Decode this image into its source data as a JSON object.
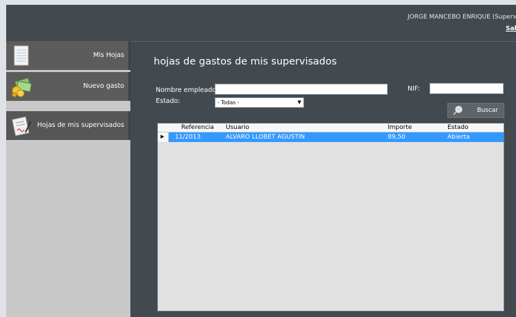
{
  "header": {
    "user": "JORGE MANCEBO ENRIQUE (Supervisor",
    "logout": "Sali"
  },
  "sidebar": {
    "items": [
      {
        "label": "Mis Hojas",
        "icon": "notepad-icon"
      },
      {
        "label": "Nuevo gasto",
        "icon": "money-icon"
      },
      {
        "label": "Hojas de mis supervisados",
        "icon": "signed-document-icon"
      }
    ]
  },
  "main": {
    "title": "hojas de gastos de mis supervisados",
    "filters": {
      "employee_label": "Nombre empleado:",
      "employee_value": "",
      "nif_label": "NIF:",
      "nif_value": "",
      "status_label": "Estado:",
      "status_selected": "- Todas -"
    },
    "search_button": "Buscar",
    "grid": {
      "columns": [
        "Referencia",
        "Usuario",
        "Importe",
        "Estado"
      ],
      "rows": [
        [
          "11/2013",
          "ALVARO LLOBET AGUSTIN",
          "89,50",
          "Abierta"
        ]
      ]
    }
  },
  "colors": {
    "background": "#424a4f",
    "sidebar_item": "#5c5c5c",
    "selection": "#3399ff"
  }
}
